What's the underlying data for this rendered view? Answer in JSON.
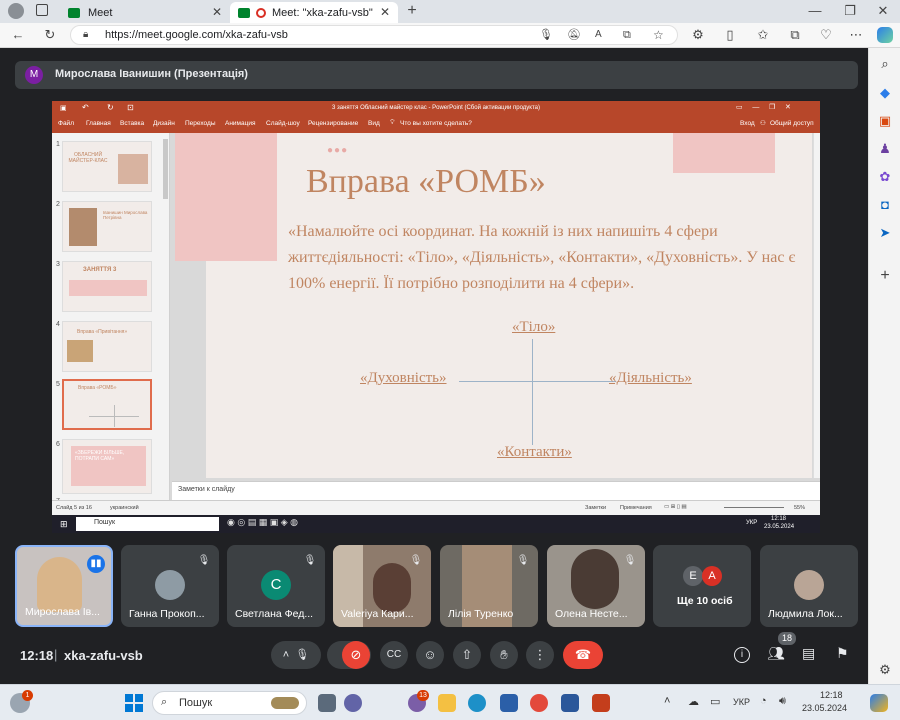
{
  "browser": {
    "tabs": [
      {
        "title": "Meet"
      },
      {
        "title": "Meet: \"xka-zafu-vsb\""
      }
    ],
    "url": "https://meet.google.com/xka-zafu-vsb"
  },
  "meet": {
    "presenter_initial": "M",
    "presenter_label": "Мирослава Іванишин (Презентація)",
    "time": "12:18",
    "separator": "|",
    "meeting_code": "xka-zafu-vsb",
    "people_count": "18",
    "participants": [
      {
        "name": "Мирослава Ів..."
      },
      {
        "name": "Ганна Прокоп..."
      },
      {
        "name": "Светлана Фед...",
        "initial": "С"
      },
      {
        "name": "Valeriya Кари..."
      },
      {
        "name": "Лілія Туренко"
      },
      {
        "name": "Олена Несте..."
      },
      {
        "name": "Ще 10 осіб",
        "initials": [
          "Е",
          "А"
        ]
      },
      {
        "name": "Людмила Лок..."
      }
    ]
  },
  "ppt": {
    "window_title": "3 заняття Обласний майстер клас - PowerPoint (Сбой активации продукта)",
    "ribbon_tabs": [
      "Файл",
      "Главная",
      "Вставка",
      "Дизайн",
      "Переходы",
      "Анимация",
      "Слайд-шоу",
      "Рецензирование",
      "Вид"
    ],
    "tell_me": "Что вы хотите сделать?",
    "signin": "Вход",
    "share": "Общий доступ",
    "thumb_numbers": [
      "1",
      "2",
      "3",
      "4",
      "5",
      "6",
      "7"
    ],
    "thumb_titles": [
      "ОБЛАСНИЙ МАЙСТЕР-КЛАС",
      "Іванишин Мирослава Петрівна",
      "ЗАНЯТТЯ 3",
      "Вправа «Привітання»",
      "Вправа «РОМБ»",
      "«ЗБЕРЕЖИ БІЛЬШЕ, ПОТРАПИ САМ»"
    ],
    "slide": {
      "title": "Вправа «РОМБ»",
      "body": "«Намалюйте осі координат. На кожній із них напишіть 4 сфери життєдіяльності: «Тіло», «Діяльність», «Контакти», «Духовність». У нас є 100% енергії. Її потрібно розподілити на 4 сфери».",
      "top": "«Тіло»",
      "left": "«Духовність»",
      "right": "«Діяльність»",
      "bottom": "«Контакти»"
    },
    "notes_placeholder": "Заметки к слайду",
    "status_slide": "Слайд 5 из 16",
    "status_lang": "украинский",
    "status_notes": "Заметки",
    "status_comments": "Примечания",
    "zoom": "55%",
    "inner_task_search": "Пошук",
    "inner_clock_time": "12:18",
    "inner_clock_date": "23.05.2024",
    "inner_lang": "УКР"
  },
  "windows": {
    "search": "Пошук",
    "lang": "УКР",
    "time": "12:18",
    "date": "23.05.2024",
    "badge_teams": "13",
    "badge_widget": "1"
  },
  "colors": {
    "accent": "#b7472a",
    "slide_bg": "#f2ece9",
    "slide_pink": "#f0c5c3",
    "slide_text": "#c08561",
    "end_call": "#ea4335"
  }
}
